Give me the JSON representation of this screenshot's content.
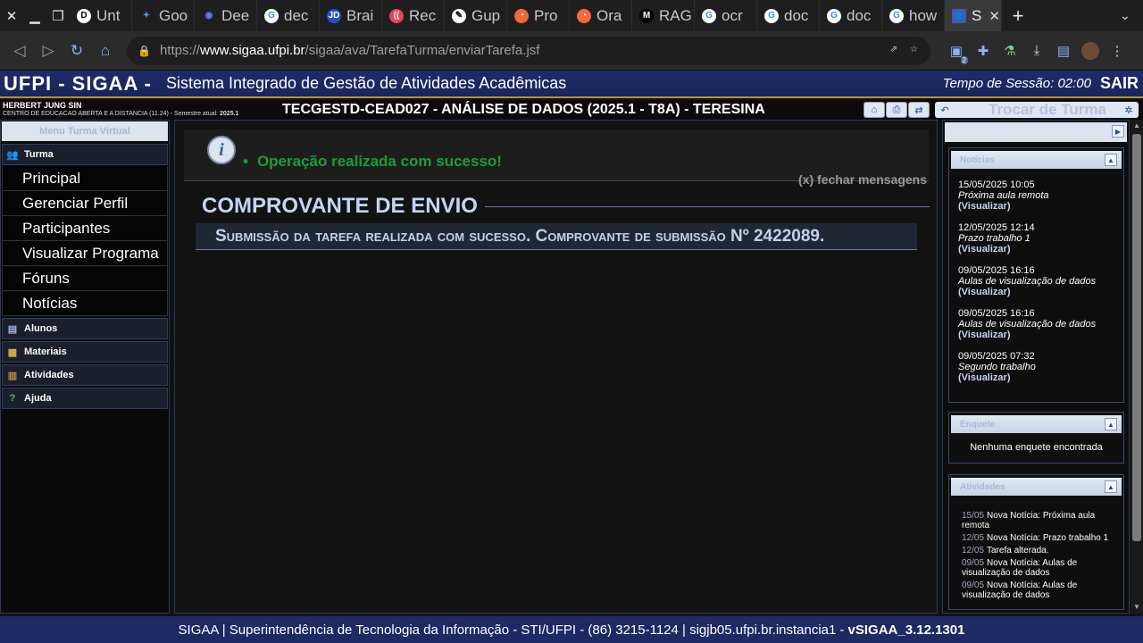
{
  "browser": {
    "tabs": [
      {
        "label": "Unt",
        "icon": "D",
        "color": "#ffffff",
        "text_color": "#000000"
      },
      {
        "label": "Goo",
        "icon": "✦",
        "color": "#1e1e1e",
        "text_color": "#5b8cff"
      },
      {
        "label": "Dee",
        "icon": "◉",
        "color": "#1e1e1e",
        "text_color": "#6b7cff"
      },
      {
        "label": "dec",
        "icon": "G",
        "color": "#ffffff",
        "text_color": "#4285f4"
      },
      {
        "label": "Brai",
        "icon": "JD",
        "color": "#2250c8",
        "text_color": "#ffffff"
      },
      {
        "label": "Rec",
        "icon": "((",
        "color": "#e8415d",
        "text_color": "#ffffff"
      },
      {
        "label": "Gup",
        "icon": "✎",
        "color": "#ffffff",
        "text_color": "#000000"
      },
      {
        "label": "Pro",
        "icon": "◔",
        "color": "#f4683a",
        "text_color": "#ffffff"
      },
      {
        "label": "Ora",
        "icon": "◔",
        "color": "#f4683a",
        "text_color": "#ffffff"
      },
      {
        "label": "RAG",
        "icon": "M",
        "color": "#000000",
        "text_color": "#ffffff"
      },
      {
        "label": "ocr",
        "icon": "G",
        "color": "#ffffff",
        "text_color": "#4285f4"
      },
      {
        "label": "doc",
        "icon": "G",
        "color": "#ffffff",
        "text_color": "#4285f4"
      },
      {
        "label": "doc",
        "icon": "G",
        "color": "#ffffff",
        "text_color": "#4285f4"
      },
      {
        "label": "how",
        "icon": "G",
        "color": "#ffffff",
        "text_color": "#4285f4"
      }
    ],
    "active_tab": {
      "label": "S",
      "icon": "👤"
    },
    "url": {
      "prefix": "https://",
      "domain": "www.sigaa.ufpi.br",
      "path": "/sigaa/ava/TarefaTurma/enviarTarefa.jsf"
    },
    "extension_badge": "2"
  },
  "header": {
    "brand": "UFPI - SIGAA -",
    "subtitle": "Sistema Integrado de Gestão de Atividades Acadêmicas",
    "session": "Tempo de Sessão: 02:00",
    "logout": "SAIR"
  },
  "coursebar": {
    "user_name": "HERBERT JUNG SIN",
    "user_center": "CENTRO DE EDUCACAO ABERTA E A DISTANCIA (11.24) - Semestre atual:",
    "semester": "2025.1",
    "course": "TECGESTD-CEAD027 - ANÁLISE DE DADOS (2025.1 - T8A) - TERESINA",
    "switch_label": "Trocar de Turma"
  },
  "menu": {
    "title": "Menu Turma Virtual",
    "turma": "Turma",
    "items": [
      "Principal",
      "Gerenciar Perfil",
      "Participantes",
      "Visualizar Programa",
      "Fóruns",
      "Notícias"
    ],
    "sections": [
      "Alunos",
      "Materiais",
      "Atividades",
      "Ajuda"
    ]
  },
  "main": {
    "success_message": "Operação realizada com sucesso!",
    "close_messages": "(x) fechar mensagens",
    "title": "COMPROVANTE DE ENVIO",
    "receipt": "Submissão da tarefa realizada com sucesso. Comprovante de submissão Nº 2422089."
  },
  "news": {
    "title": "Notícias",
    "items": [
      {
        "date": "15/05/2025 10:05",
        "title": "Próxima aula remota",
        "link": "(Visualizar)"
      },
      {
        "date": "12/05/2025 12:14",
        "title": "Prazo trabalho 1",
        "link": "(Visualizar)"
      },
      {
        "date": "09/05/2025 16:16",
        "title": "Aulas de visualização de dados",
        "link": "(Visualizar)"
      },
      {
        "date": "09/05/2025 16:16",
        "title": "Aulas de visualização de dados",
        "link": "(Visualizar)"
      },
      {
        "date": "09/05/2025 07:32",
        "title": "Segundo trabalho",
        "link": "(Visualizar)"
      }
    ]
  },
  "poll": {
    "title": "Enquete",
    "empty": "Nenhuma enquete encontrada"
  },
  "activities": {
    "title": "Atividades",
    "items": [
      {
        "date": "15/05",
        "text": "Nova Notícia: Próxima aula remota"
      },
      {
        "date": "12/05",
        "text": "Nova Notícia: Prazo trabalho 1"
      },
      {
        "date": "12/05",
        "text": "Tarefa alterada."
      },
      {
        "date": "09/05",
        "text": "Nova Notícia: Aulas de visualização de dados"
      },
      {
        "date": "09/05",
        "text": "Nova Notícia: Aulas de visualização de dados"
      }
    ]
  },
  "footer": {
    "text": "SIGAA | Superintendência de Tecnologia da Informação - STI/UFPI - (86) 3215-1124 | sigjb05.ufpi.br.instancia1 -",
    "version": "vSIGAA_3.12.1301"
  }
}
